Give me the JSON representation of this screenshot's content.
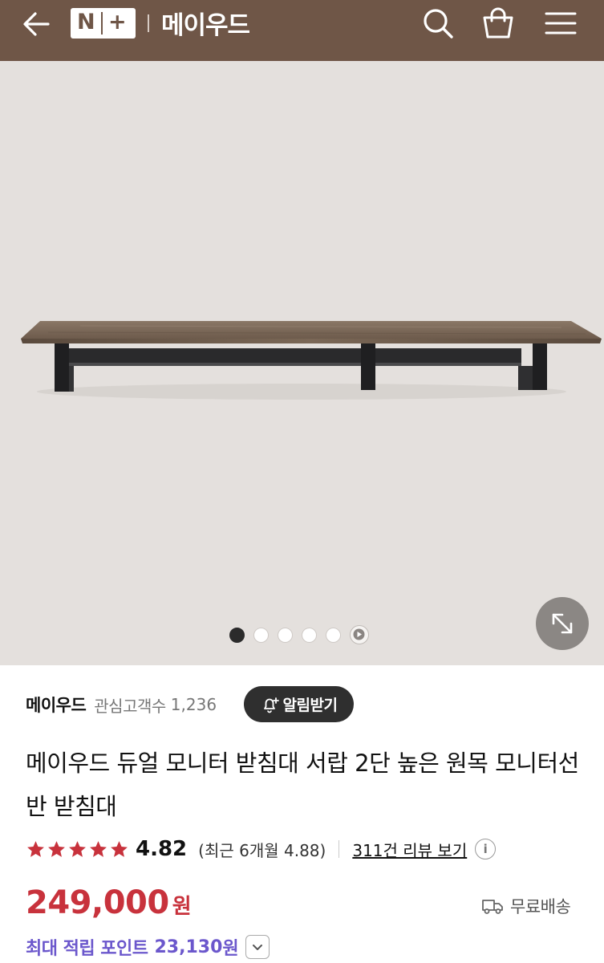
{
  "header": {
    "logo_letters": [
      "N",
      "+"
    ],
    "store_name": "메이우드",
    "colors": {
      "background": "#6f5647",
      "icon": "#ffffff"
    },
    "icons": [
      "back-arrow-icon",
      "search-icon",
      "shopping-bag-icon",
      "hamburger-menu-icon"
    ]
  },
  "gallery": {
    "slide_count": 5,
    "active_index": 0,
    "has_video": true,
    "zoom_icon": "expand-icon"
  },
  "brand": {
    "name": "메이우드",
    "fav_label": "관심고객수",
    "fav_count": "1,236",
    "alarm_label": "알림받기"
  },
  "product": {
    "title": "메이우드 듀얼 모니터 받침대 서랍 2단 높은 원목 모니터선반 받침대"
  },
  "rating": {
    "stars": 5,
    "value": "4.82",
    "recent": "(최근 6개월 4.88)",
    "review_link": "311건 리뷰 보기",
    "info_glyph": "i"
  },
  "price": {
    "amount": "249,000",
    "currency": "원",
    "color": "#c8323c",
    "shipping": "무료배송"
  },
  "points": {
    "label": "최대 적립 포인트",
    "value": "23,130",
    "unit": "원",
    "color": "#6b57cc"
  }
}
